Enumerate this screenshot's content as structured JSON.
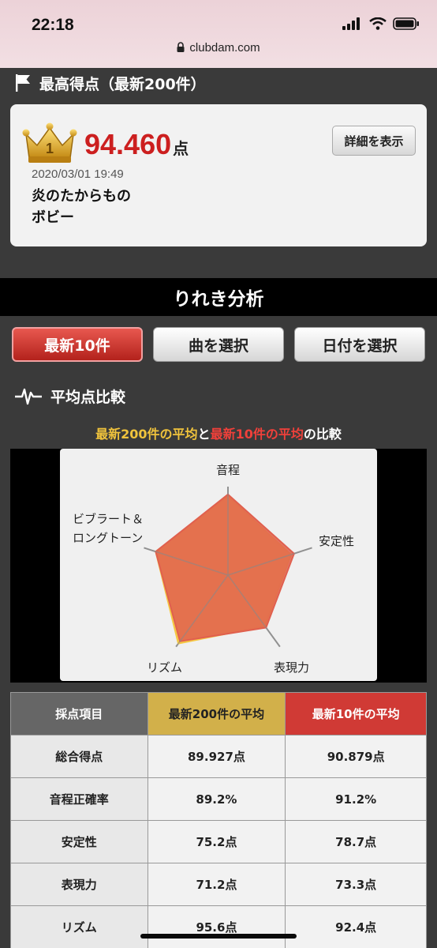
{
  "status": {
    "time": "22:18",
    "url": "clubdam.com"
  },
  "best": {
    "heading": "最高得点（最新200件）",
    "score": "94.460",
    "unit": "点",
    "detail_label": "詳細を表示",
    "date": "2020/03/01 19:49",
    "song": "炎のたからもの",
    "artist": "ボビー"
  },
  "history": {
    "title": "りれき分析",
    "tabs": [
      "最新10件",
      "曲を選択",
      "日付を選択"
    ]
  },
  "avg": {
    "heading": "平均点比較",
    "note_gold": "最新200件の平均",
    "note_and": "と",
    "note_red": "最新10件の平均",
    "note_tail": "の比較"
  },
  "chart_data": {
    "type": "radar",
    "axes": [
      "音程",
      "安定性",
      "表現力",
      "リズム",
      "ビブラート＆ロングトーン"
    ],
    "axis_label_lines": [
      "音程",
      "安定性",
      "表現力",
      "リズム",
      "ビブラート＆",
      "ロングトーン"
    ],
    "series": [
      {
        "name": "最新200件の平均",
        "color": "#f5c842",
        "values": [
          89.2,
          75.2,
          71.2,
          95.6,
          86.0
        ]
      },
      {
        "name": "最新10件の平均",
        "color": "#e0604e",
        "values": [
          91.2,
          78.7,
          73.3,
          92.4,
          86.0
        ]
      }
    ],
    "range": [
      0,
      100
    ]
  },
  "table": {
    "headers": [
      "採点項目",
      "最新200件の平均",
      "最新10件の平均"
    ],
    "rows": [
      [
        "総合得点",
        "89.927点",
        "90.879点"
      ],
      [
        "音程正確率",
        "89.2%",
        "91.2%"
      ],
      [
        "安定性",
        "75.2点",
        "78.7点"
      ],
      [
        "表現力",
        "71.2点",
        "73.3点"
      ],
      [
        "リズム",
        "95.6点",
        "92.4点"
      ]
    ]
  }
}
